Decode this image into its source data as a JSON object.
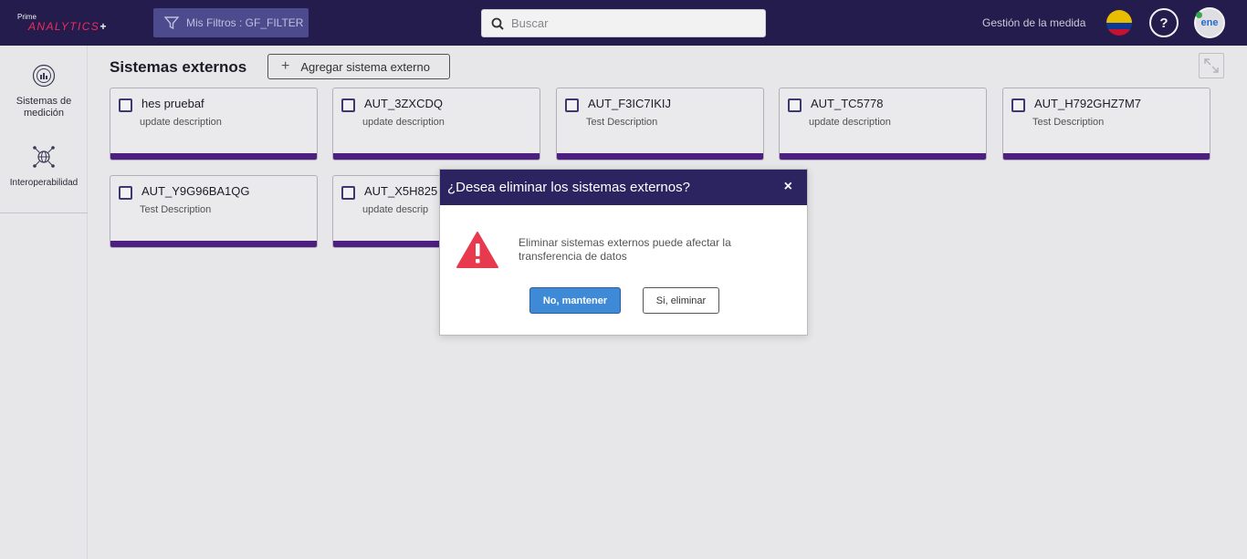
{
  "header": {
    "logo_prime": "Prime",
    "logo_analytics": "ANALYTICS",
    "logo_plus": "+",
    "filter_label": "Mis Filtros : GF_FILTER",
    "search_placeholder": "Buscar",
    "gestion_label": "Gestión de la medida",
    "help_label": "?",
    "avatar_text": "ene"
  },
  "sidebar": {
    "items": [
      {
        "label": "Sistemas de medición",
        "icon": "gauge-chart-icon"
      },
      {
        "label": "Interoperabilidad",
        "icon": "network-globe-icon"
      }
    ]
  },
  "main": {
    "title": "Sistemas externos",
    "add_button_label": "Agregar sistema externo",
    "cards": [
      {
        "name": "hes pruebaf",
        "description": "update description"
      },
      {
        "name": "AUT_3ZXCDQ",
        "description": "update description"
      },
      {
        "name": "AUT_F3IC7IKIJ",
        "description": "Test Description"
      },
      {
        "name": "AUT_TC5778",
        "description": "update description"
      },
      {
        "name": "AUT_H792GHZ7M7",
        "description": "Test Description"
      },
      {
        "name": "AUT_Y9G96BA1QG",
        "description": "Test Description"
      },
      {
        "name": "AUT_X5H825",
        "description": "update descrip"
      }
    ]
  },
  "dialog": {
    "title": "¿Desea eliminar los sistemas externos?",
    "close_label": "×",
    "message": "Eliminar sistemas externos puede afectar la transferencia de datos",
    "cancel_label": "No, mantener",
    "confirm_label": "Si, eliminar"
  },
  "colors": {
    "topbar": "#251c4f",
    "card_bar": "#4f1f86",
    "dialog_header": "#2b2461",
    "primary_button": "#3e8ad6",
    "warning": "#e83a4f"
  }
}
